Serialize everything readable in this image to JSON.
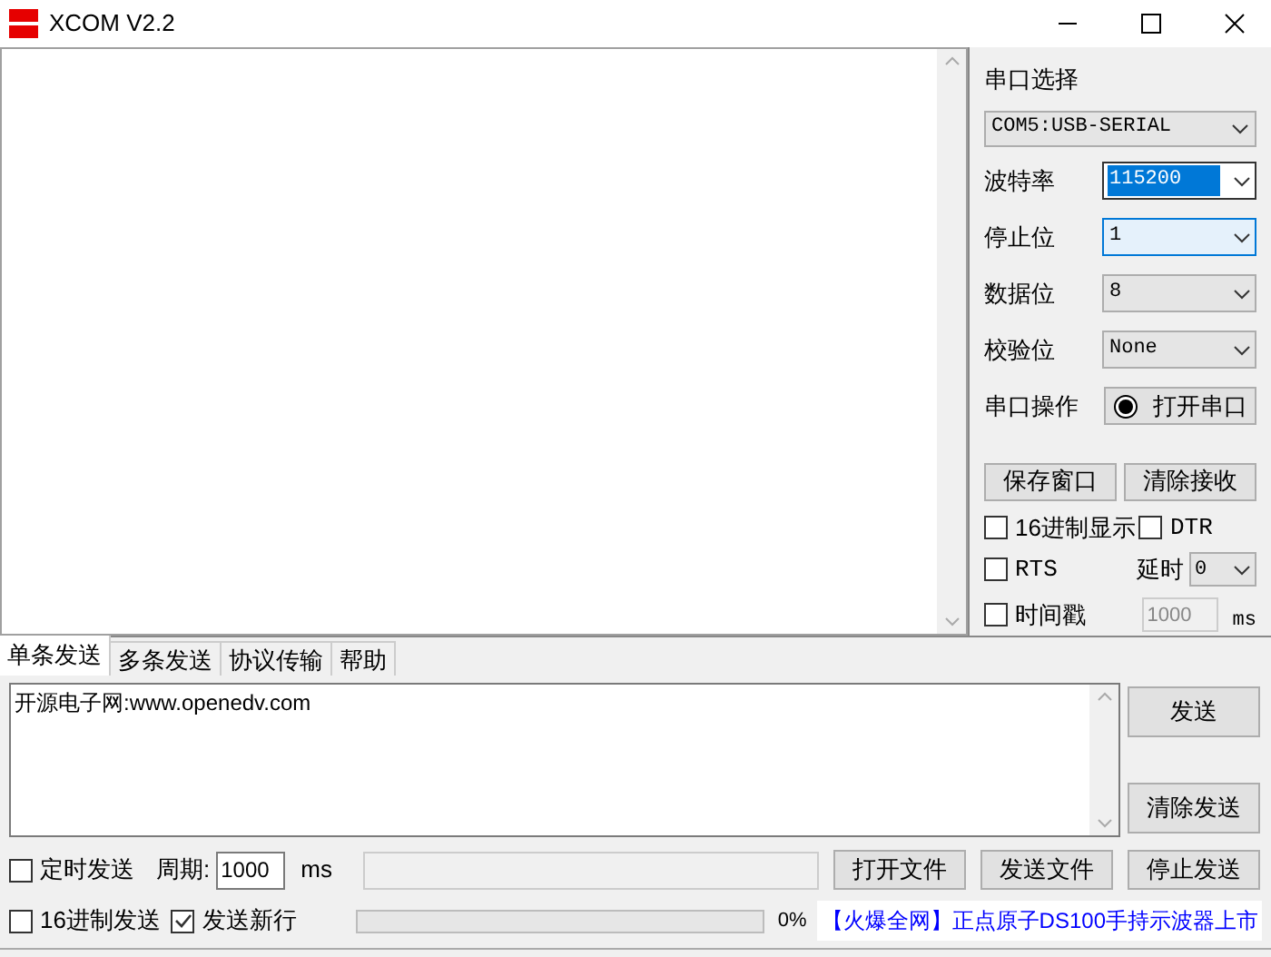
{
  "window": {
    "title": "XCOM V2.2"
  },
  "serial_panel": {
    "port_label": "串口选择",
    "port": "COM5:USB-SERIAL",
    "settings": [
      {
        "label": "波特率",
        "value": "115200",
        "focused": true,
        "hovered": false
      },
      {
        "label": "停止位",
        "value": "1",
        "focused": false,
        "hovered": true
      },
      {
        "label": "数据位",
        "value": "8",
        "focused": false,
        "hovered": false
      },
      {
        "label": "校验位",
        "value": "None",
        "focused": false,
        "hovered": false
      }
    ],
    "operation_label": "串口操作",
    "open_button": {
      "label": "打开串口",
      "on": false
    },
    "save_button": "保存窗口",
    "clear_button": "清除接收",
    "hex_display": {
      "label": "16进制显示",
      "checked": false
    },
    "dtr": {
      "label": "DTR",
      "checked": false
    },
    "rts": {
      "label": "RTS",
      "checked": false
    },
    "delay": {
      "label": "延时",
      "value": "0"
    },
    "timestamp": {
      "label": "时间戳",
      "checked": false,
      "disabled": true,
      "value": "1000",
      "unit": "ms"
    }
  },
  "tabs": [
    {
      "label": "单条发送",
      "selected": true
    },
    {
      "label": "多条发送",
      "selected": false
    },
    {
      "label": "协议传输",
      "selected": false
    },
    {
      "label": "帮助",
      "selected": false
    }
  ],
  "send_text": "开源电子网:www.openedv.com",
  "send_button": "发送",
  "clear_send_button": "清除发送",
  "timed_send": {
    "label": "定时发送",
    "checked": false
  },
  "period": {
    "label": "周期:",
    "value": "1000",
    "unit": "ms"
  },
  "file_buttons": [
    "打开文件",
    "发送文件",
    "停止发送"
  ],
  "hex_send": {
    "label": "16进制发送",
    "checked": false
  },
  "send_newline": {
    "label": "发送新行",
    "checked": true
  },
  "progress": {
    "level": 0,
    "reading": "0%"
  },
  "ad_link": "【火爆全网】正点原子DS100手持示波器上市"
}
